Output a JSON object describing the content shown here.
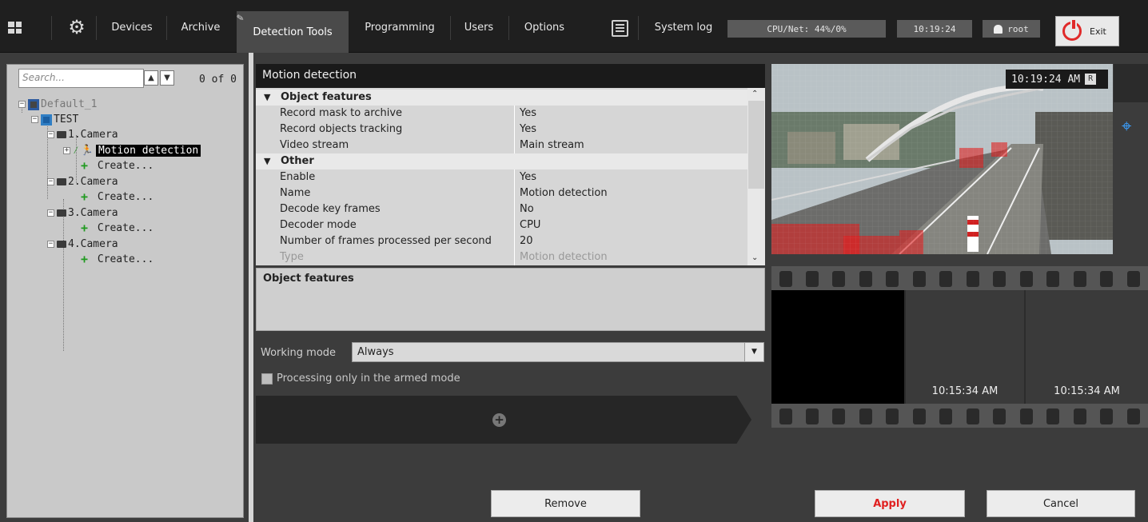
{
  "topbar": {
    "tabs": [
      "Devices",
      "Archive",
      "Detection Tools",
      "Programming",
      "Users",
      "Options"
    ],
    "system_log": "System log",
    "cpu_net": "CPU/Net: 44%/0%",
    "clock": "10:19:24",
    "user": "root",
    "exit": "Exit"
  },
  "tree": {
    "search_placeholder": "Search...",
    "count": "0 of 0",
    "server": "Default_1",
    "domain": "TEST",
    "cameras": [
      "1.Camera",
      "2.Camera",
      "3.Camera",
      "4.Camera"
    ],
    "detector": "Motion detection",
    "create_label": "Create..."
  },
  "properties": {
    "title": "Motion detection",
    "groups": [
      {
        "name": "Object features",
        "rows": [
          {
            "key": "Record mask to archive",
            "value": "Yes"
          },
          {
            "key": "Record objects tracking",
            "value": "Yes"
          },
          {
            "key": "Video stream",
            "value": "Main stream"
          }
        ]
      },
      {
        "name": "Other",
        "rows": [
          {
            "key": "Enable",
            "value": "Yes"
          },
          {
            "key": "Name",
            "value": "Motion detection"
          },
          {
            "key": "Decode key frames",
            "value": "No"
          },
          {
            "key": "Decoder mode",
            "value": "CPU"
          },
          {
            "key": "Number of frames processed per second",
            "value": "20"
          },
          {
            "key": "Type",
            "value": "Motion detection"
          }
        ]
      }
    ],
    "description_title": "Object features"
  },
  "working_mode": {
    "label": "Working mode",
    "value": "Always"
  },
  "armed_checkbox": {
    "label": "Processing only in the armed mode",
    "checked": false
  },
  "buttons": {
    "remove": "Remove",
    "apply": "Apply",
    "cancel": "Cancel"
  },
  "video": {
    "timestamp": "10:19:24 AM",
    "r_badge": "R",
    "thumb_times": [
      "10:15:34 AM",
      "10:15:34 AM"
    ]
  },
  "colors": {
    "apply_text": "#e02020",
    "motion_mask": "#e02020",
    "active_tab": "#4a4a4a"
  }
}
